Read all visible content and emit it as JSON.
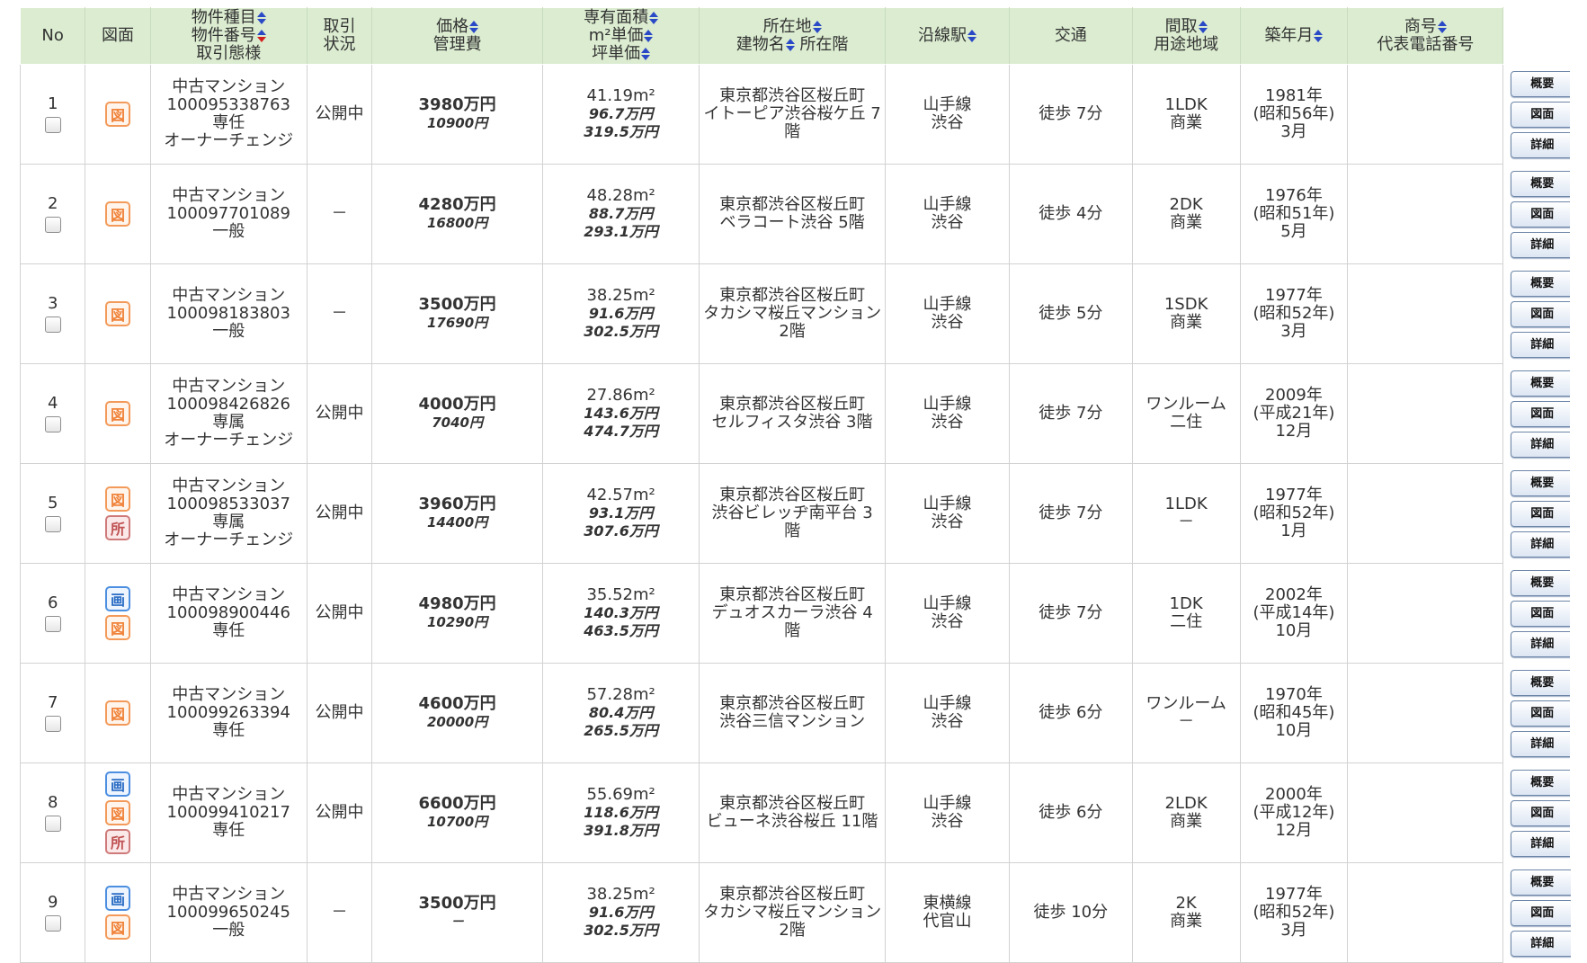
{
  "header": {
    "no": "No",
    "zumen": "図面",
    "type": [
      "物件種目",
      "物件番号",
      "取引態様"
    ],
    "status": [
      "取引",
      "状況"
    ],
    "price": [
      "価格",
      "管理費"
    ],
    "area": [
      "専有面積",
      "m²単価",
      "坪単価"
    ],
    "address": [
      "所在地",
      "建物名",
      "所在階"
    ],
    "station": "沿線駅",
    "transport": "交通",
    "layout": [
      "間取",
      "用途地域"
    ],
    "built": "築年月",
    "company": [
      "商号",
      "代表電話番号"
    ]
  },
  "buttons": {
    "summary": "概要",
    "plan": "図面",
    "detail": "詳細"
  },
  "icons": {
    "zu": "図",
    "ga": "画",
    "sho": "所"
  },
  "rows": [
    {
      "no": "1",
      "icons": [
        "zu"
      ],
      "kind": "中古マンション",
      "id": "100095338763",
      "deal": [
        "専任",
        "オーナーチェンジ"
      ],
      "status": "公開中",
      "price": "3980万円",
      "fee": "10900円",
      "area": "41.19m²",
      "sqm": "96.7万円",
      "tsubo": "319.5万円",
      "addr": [
        "東京都渋谷区桜丘町",
        "イトーピア渋谷桜ケ丘 7",
        "階"
      ],
      "line": "山手線",
      "station": "渋谷",
      "walk": "徒歩 7分",
      "layout": "1LDK",
      "zone": "商業",
      "built": [
        "1981年",
        "(昭和56年)",
        "3月"
      ]
    },
    {
      "no": "2",
      "icons": [
        "zu"
      ],
      "kind": "中古マンション",
      "id": "100097701089",
      "deal": [
        "一般"
      ],
      "status": "－",
      "price": "4280万円",
      "fee": "16800円",
      "area": "48.28m²",
      "sqm": "88.7万円",
      "tsubo": "293.1万円",
      "addr": [
        "東京都渋谷区桜丘町",
        "ベラコート渋谷 5階"
      ],
      "line": "山手線",
      "station": "渋谷",
      "walk": "徒歩 4分",
      "layout": "2DK",
      "zone": "商業",
      "built": [
        "1976年",
        "(昭和51年)",
        "5月"
      ]
    },
    {
      "no": "3",
      "icons": [
        "zu"
      ],
      "kind": "中古マンション",
      "id": "100098183803",
      "deal": [
        "一般"
      ],
      "status": "－",
      "price": "3500万円",
      "fee": "17690円",
      "area": "38.25m²",
      "sqm": "91.6万円",
      "tsubo": "302.5万円",
      "addr": [
        "東京都渋谷区桜丘町",
        "タカシマ桜丘マンション",
        "2階"
      ],
      "line": "山手線",
      "station": "渋谷",
      "walk": "徒歩 5分",
      "layout": "1SDK",
      "zone": "商業",
      "built": [
        "1977年",
        "(昭和52年)",
        "3月"
      ]
    },
    {
      "no": "4",
      "icons": [
        "zu"
      ],
      "kind": "中古マンション",
      "id": "100098426826",
      "deal": [
        "専属",
        "オーナーチェンジ"
      ],
      "status": "公開中",
      "price": "4000万円",
      "fee": "7040円",
      "area": "27.86m²",
      "sqm": "143.6万円",
      "tsubo": "474.7万円",
      "addr": [
        "東京都渋谷区桜丘町",
        "セルフィスタ渋谷 3階"
      ],
      "line": "山手線",
      "station": "渋谷",
      "walk": "徒歩 7分",
      "layout": "ワンルーム",
      "zone": "二住",
      "built": [
        "2009年",
        "(平成21年)",
        "12月"
      ]
    },
    {
      "no": "5",
      "icons": [
        "zu",
        "sho"
      ],
      "kind": "中古マンション",
      "id": "100098533037",
      "deal": [
        "専属",
        "オーナーチェンジ"
      ],
      "status": "公開中",
      "price": "3960万円",
      "fee": "14400円",
      "area": "42.57m²",
      "sqm": "93.1万円",
      "tsubo": "307.6万円",
      "addr": [
        "東京都渋谷区桜丘町",
        "渋谷ビレッヂ南平台 3",
        "階"
      ],
      "line": "山手線",
      "station": "渋谷",
      "walk": "徒歩 7分",
      "layout": "1LDK",
      "zone": "－",
      "built": [
        "1977年",
        "(昭和52年)",
        "1月"
      ]
    },
    {
      "no": "6",
      "icons": [
        "ga",
        "zu"
      ],
      "kind": "中古マンション",
      "id": "100098900446",
      "deal": [
        "専任"
      ],
      "status": "公開中",
      "price": "4980万円",
      "fee": "10290円",
      "area": "35.52m²",
      "sqm": "140.3万円",
      "tsubo": "463.5万円",
      "addr": [
        "東京都渋谷区桜丘町",
        "デュオスカーラ渋谷 4",
        "階"
      ],
      "line": "山手線",
      "station": "渋谷",
      "walk": "徒歩 7分",
      "layout": "1DK",
      "zone": "二住",
      "built": [
        "2002年",
        "(平成14年)",
        "10月"
      ]
    },
    {
      "no": "7",
      "icons": [
        "zu"
      ],
      "kind": "中古マンション",
      "id": "100099263394",
      "deal": [
        "専任"
      ],
      "status": "公開中",
      "price": "4600万円",
      "fee": "20000円",
      "area": "57.28m²",
      "sqm": "80.4万円",
      "tsubo": "265.5万円",
      "addr": [
        "東京都渋谷区桜丘町",
        "渋谷三信マンション"
      ],
      "line": "山手線",
      "station": "渋谷",
      "walk": "徒歩 6分",
      "layout": "ワンルーム",
      "zone": "－",
      "built": [
        "1970年",
        "(昭和45年)",
        "10月"
      ]
    },
    {
      "no": "8",
      "icons": [
        "ga",
        "zu",
        "sho"
      ],
      "kind": "中古マンション",
      "id": "100099410217",
      "deal": [
        "専任"
      ],
      "status": "公開中",
      "price": "6600万円",
      "fee": "10700円",
      "area": "55.69m²",
      "sqm": "118.6万円",
      "tsubo": "391.8万円",
      "addr": [
        "東京都渋谷区桜丘町",
        "ビューネ渋谷桜丘 11階"
      ],
      "line": "山手線",
      "station": "渋谷",
      "walk": "徒歩 6分",
      "layout": "2LDK",
      "zone": "商業",
      "built": [
        "2000年",
        "(平成12年)",
        "12月"
      ]
    },
    {
      "no": "9",
      "icons": [
        "ga",
        "zu"
      ],
      "kind": "中古マンション",
      "id": "100099650245",
      "deal": [
        "一般"
      ],
      "status": "－",
      "price": "3500万円",
      "fee": "－",
      "area": "38.25m²",
      "sqm": "91.6万円",
      "tsubo": "302.5万円",
      "addr": [
        "東京都渋谷区桜丘町",
        "タカシマ桜丘マンション",
        "2階"
      ],
      "line": "東横線",
      "station": "代官山",
      "walk": "徒歩 10分",
      "layout": "2K",
      "zone": "商業",
      "built": [
        "1977年",
        "(昭和52年)",
        "3月"
      ]
    }
  ]
}
